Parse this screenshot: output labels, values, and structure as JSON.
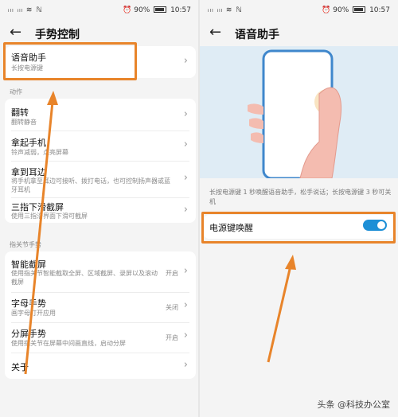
{
  "status": {
    "left": "ᵢₗₗ ᵢₗₗ ≋ ℕ",
    "battery_pct": "90%",
    "time": "10:57"
  },
  "left_screen": {
    "title": "手势控制",
    "highlighted_item": {
      "title": "语音助手",
      "subtitle": "长按电源键"
    },
    "section_actions": "动作",
    "actions": [
      {
        "title": "翻转",
        "subtitle": "翻转静音"
      },
      {
        "title": "拿起手机",
        "subtitle": "铃声减弱，点亮屏幕"
      },
      {
        "title": "拿到耳边",
        "subtitle": "将手机拿至耳边可接听、拨打电话，也可控制扬声器或蓝牙耳机"
      },
      {
        "title": "三指下滑截屏",
        "subtitle": "使用三指沿界面下滑可截屏"
      }
    ],
    "section_knuckle": "指关节手势",
    "knuckle": [
      {
        "title": "智能截屏",
        "subtitle": "使用指关节智能截取全屏、区域截屏、录屏以及滚动截屏",
        "value": "开启"
      },
      {
        "title": "字母手势",
        "subtitle": "画字母打开应用",
        "value": "关闭"
      },
      {
        "title": "分屏手势",
        "subtitle": "使用指关节在屏幕中间画直线，启动分屏",
        "value": "开启"
      },
      {
        "title": "关于",
        "subtitle": "",
        "value": ""
      }
    ]
  },
  "right_screen": {
    "title": "语音助手",
    "description": "长按电源键 1 秒唤醒语音助手，松手说话；长按电源键 3 秒可关机",
    "toggle_label": "电源键唤醒",
    "toggle_state": "on"
  },
  "watermark": "头条 @科技办公室",
  "colors": {
    "highlight": "#e8842a",
    "toggle": "#1d8fd6"
  }
}
